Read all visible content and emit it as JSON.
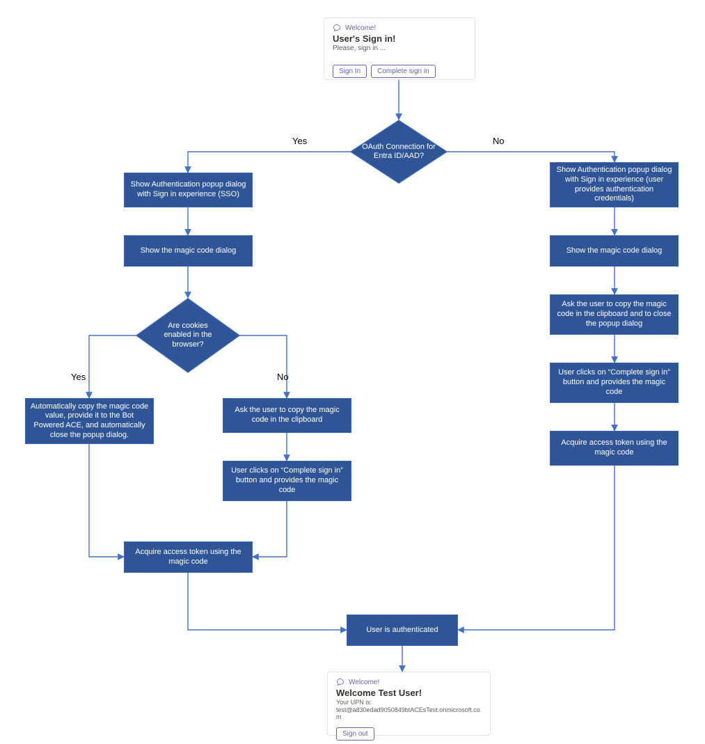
{
  "colors": {
    "box_fill": "#2f5597",
    "box_border": "#3a66b1",
    "line": "#4472c4",
    "accent": "#6264a7"
  },
  "card_signin": {
    "welcome": "Welcome!",
    "title": "User's Sign in!",
    "subtitle": "Please, sign in ...",
    "btn_signin": "Sign In",
    "btn_complete": "Complete sign in"
  },
  "decision_oauth": "OAuth Connection for Entra ID/AAD?",
  "label_oauth_yes": "Yes",
  "label_oauth_no": "No",
  "left_sso": "Show Authentication popup dialog with Sign in experience (SSO)",
  "left_magic": "Show the magic code dialog",
  "decision_cookies": "Are cookies enabled in the browser?",
  "label_cookies_yes": "Yes",
  "label_cookies_no": "No",
  "left_auto_copy": "Automatically copy the magic code value, provide it to the Bot Powered ACE, and automatically close the popup dialog.",
  "left_ask_copy": "Ask the user to copy the magic code in the clipboard",
  "left_complete_click": "User clicks on “Complete sign in” button and provides the magic code",
  "left_acquire_token": "Acquire access token using the magic code",
  "right_popup": "Show Authentication popup dialog with Sign in experience (user provides authentication credentials)",
  "right_magic": "Show the magic code dialog",
  "right_ask_copy": "Ask the user to copy the magic code in the clipboard and to close the popup dialog",
  "right_complete_click": "User clicks on “Complete sign in” button and provides the magic code",
  "right_acquire_token": "Acquire access token using the magic code",
  "authenticated": "User is authenticated",
  "card_welcome": {
    "welcome": "Welcome!",
    "title": "Welcome Test User!",
    "upn_label": "Your UPN is:",
    "upn_value": "test@a830edad9050849btACEsTest.onmicrosoft.com",
    "btn_signout": "Sign out"
  }
}
